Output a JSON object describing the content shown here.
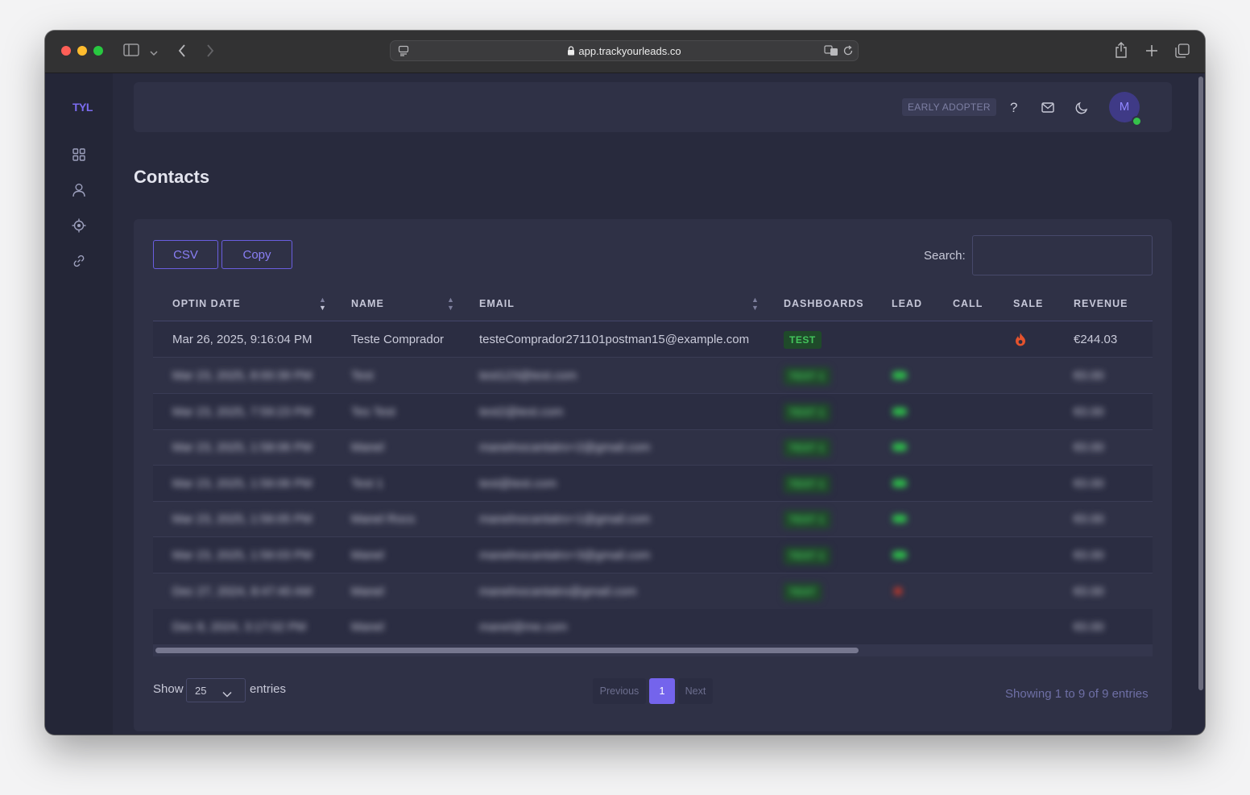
{
  "browser": {
    "url": "app.trackyourleads.co"
  },
  "sidebar": {
    "logo": "TYL",
    "items": [
      {
        "icon": "dashboard-grid-icon"
      },
      {
        "icon": "user-icon"
      },
      {
        "icon": "target-icon"
      },
      {
        "icon": "link-icon"
      }
    ]
  },
  "header": {
    "badge": "EARLY ADOPTER",
    "help_label": "?",
    "avatar_initial": "M"
  },
  "page": {
    "title": "Contacts"
  },
  "toolbar": {
    "csv_label": "CSV",
    "copy_label": "Copy",
    "search_label": "Search:",
    "search_value": ""
  },
  "table": {
    "columns": [
      "OPTIN DATE",
      "NAME",
      "EMAIL",
      "DASHBOARDS",
      "LEAD",
      "CALL",
      "SALE",
      "REVENUE"
    ],
    "rows": [
      {
        "optin_date": "Mar 26, 2025, 9:16:04 PM",
        "name": "Teste Comprador",
        "email": "testeComprador271101postman15@example.com",
        "dashboard": "TEST",
        "lead": "",
        "call": "",
        "sale": "fire-icon",
        "revenue": "€244.03"
      },
      {
        "optin_date": "Mar 23, 2025, 8:00:39 PM",
        "name": "Test",
        "email": "test123@test.com",
        "dashboard": "TEST 1",
        "lead": "lead-badge",
        "call": "",
        "sale": "",
        "revenue": "€0.00"
      },
      {
        "optin_date": "Mar 23, 2025, 7:59:23 PM",
        "name": "Tes Test",
        "email": "test2@test.com",
        "dashboard": "TEST 1",
        "lead": "lead-badge",
        "call": "",
        "sale": "",
        "revenue": "€0.00"
      },
      {
        "optin_date": "Mar 23, 2025, 1:58:06 PM",
        "name": "Manel",
        "email": "manelnocantatro+2@gmail.com",
        "dashboard": "TEST 1",
        "lead": "lead-badge",
        "call": "",
        "sale": "",
        "revenue": "€0.00"
      },
      {
        "optin_date": "Mar 23, 2025, 1:56:06 PM",
        "name": "Test 1",
        "email": "test@test.com",
        "dashboard": "TEST 1",
        "lead": "lead-badge",
        "call": "",
        "sale": "",
        "revenue": "€0.00"
      },
      {
        "optin_date": "Mar 23, 2025, 1:56:05 PM",
        "name": "Manel Rocs",
        "email": "manelnocantatro+1@gmail.com",
        "dashboard": "TEST 1",
        "lead": "lead-badge",
        "call": "",
        "sale": "",
        "revenue": "€0.00"
      },
      {
        "optin_date": "Mar 23, 2025, 1:56:03 PM",
        "name": "Manel",
        "email": "manelnocantatro+3@gmail.com",
        "dashboard": "TEST 1",
        "lead": "lead-badge",
        "call": "",
        "sale": "",
        "revenue": "€0.00"
      },
      {
        "optin_date": "Dec 27, 2024, 8:47:40 AM",
        "name": "Manel",
        "email": "manelnocantatro@gmail.com",
        "dashboard": "TEST",
        "lead": "lead-badge-red",
        "call": "",
        "sale": "",
        "revenue": "€0.00"
      },
      {
        "optin_date": "Dec 8, 2024, 3:17:02 PM",
        "name": "Manel",
        "email": "manel@me.com",
        "dashboard": "",
        "lead": "",
        "call": "",
        "sale": "",
        "revenue": "€0.00"
      }
    ]
  },
  "footer": {
    "show_label": "Show",
    "page_size": "25",
    "entries_label": "entries",
    "previous_label": "Previous",
    "current_page": "1",
    "next_label": "Next",
    "info": "Showing 1 to 9 of 9 entries"
  },
  "colors": {
    "accent": "#6c5ce7",
    "background": "#282a3d",
    "card": "#2f3146",
    "success": "#2dbf4a",
    "fire": "#e5532d"
  }
}
